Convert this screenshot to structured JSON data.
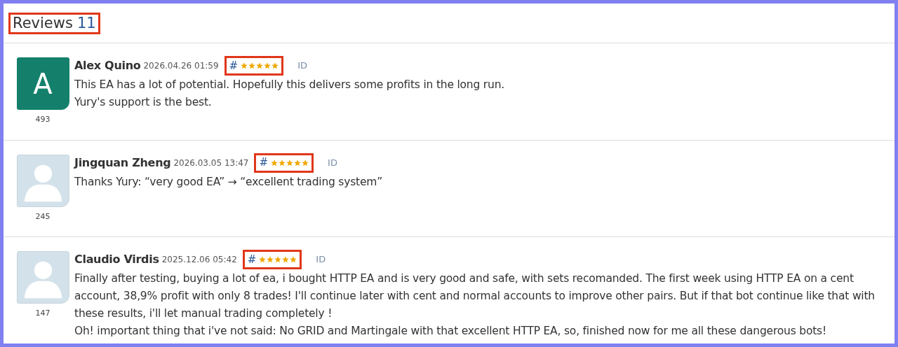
{
  "header": {
    "title": "Reviews",
    "count": "11",
    "highlighted": true
  },
  "reviews": [
    {
      "author": "Alex Quino",
      "date": "2026.04.26 01:59",
      "anchor": "#",
      "stars": 5,
      "highlighted": true,
      "id_link": "ID",
      "avatar": {
        "kind": "letter",
        "letter": "A",
        "color": "#14806b"
      },
      "score": "493",
      "paragraphs": [
        "This EA has a lot of potential. Hopefully this delivers some profits in the long run.",
        "Yury's support is the best."
      ]
    },
    {
      "author": "Jingquan Zheng",
      "date": "2026.03.05 13:47",
      "anchor": "#",
      "stars": 5,
      "highlighted": true,
      "id_link": "ID",
      "avatar": {
        "kind": "silhouette"
      },
      "score": "245",
      "paragraphs": [
        "Thanks Yury: “very good EA” → “excellent trading system”"
      ]
    },
    {
      "author": "Claudio Virdis",
      "date": "2025.12.06 05:42",
      "anchor": "#",
      "stars": 5,
      "highlighted": true,
      "id_link": "ID",
      "avatar": {
        "kind": "silhouette"
      },
      "score": "147",
      "paragraphs": [
        "Finally after testing, buying a lot of ea, i bought HTTP EA and is very good and safe, with sets recomanded. The first week using HTTP EA on a cent account, 38,9% profit with only 8 trades! I'll continue later with cent and normal accounts to improve other pairs. But if that bot continue like that with these results, i'll let manual trading completely !",
        "Oh! important thing that i've not said: No GRID and Martingale with that excellent HTTP EA, so, finished now for me all these dangerous bots!"
      ]
    }
  ]
}
